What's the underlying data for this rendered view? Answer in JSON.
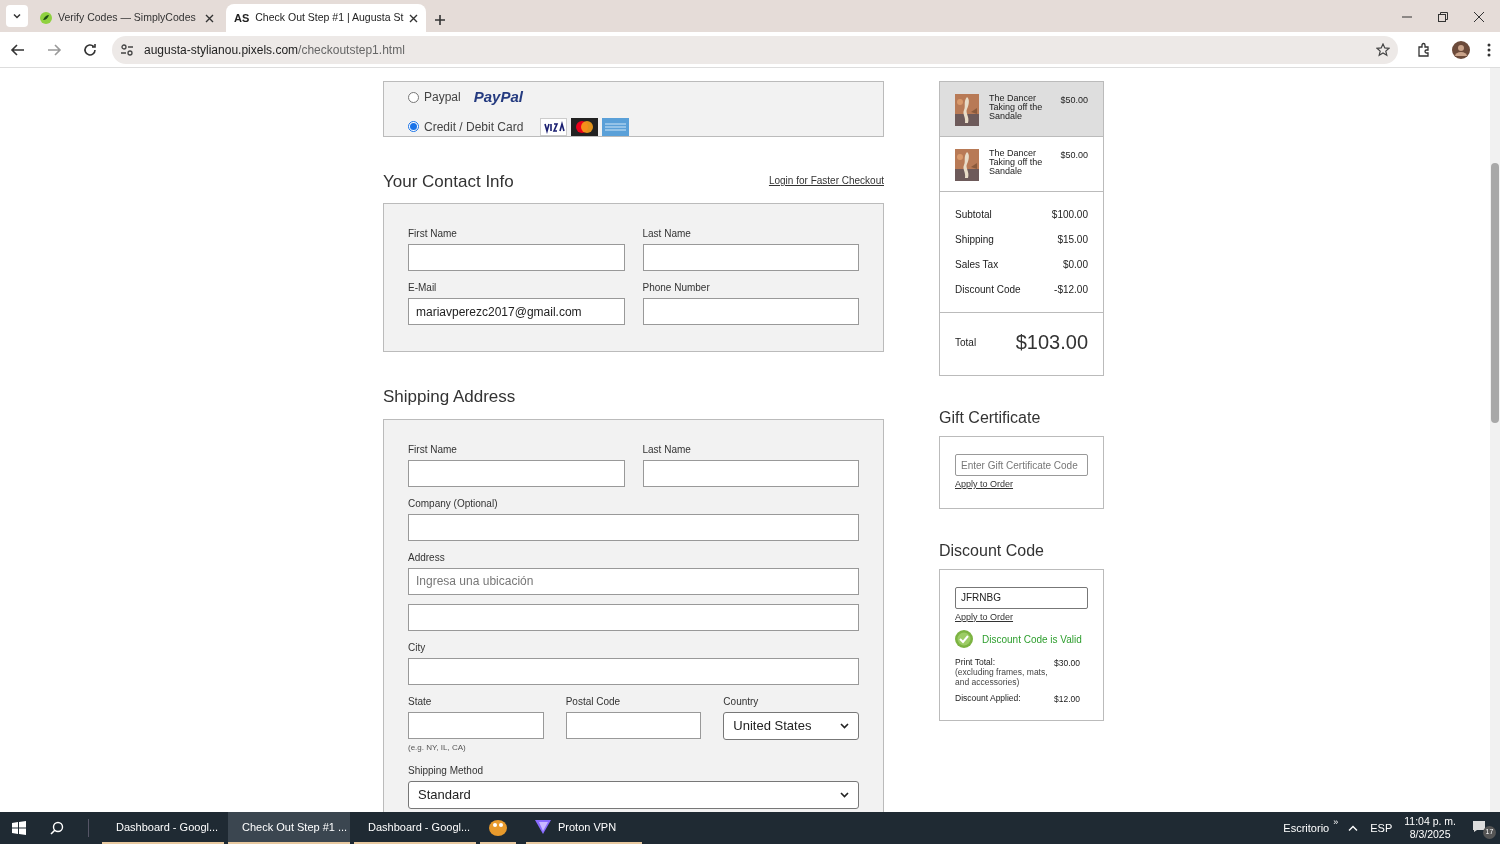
{
  "browser": {
    "tabs": [
      {
        "label": "Verify Codes — SimplyCodes",
        "selected": false,
        "kind": "leaf"
      },
      {
        "label": "Check Out Step #1 | Augusta St",
        "selected": true,
        "kind": "monogram",
        "monogram": "AS"
      }
    ],
    "url_host": "augusta-stylianou.pixels.com",
    "url_path": "/checkoutstep1.html"
  },
  "payment": {
    "options": [
      {
        "label": "Paypal",
        "selected": false,
        "kind": "paypal",
        "logo": "PayPal"
      },
      {
        "label": "Credit / Debit Card",
        "selected": true,
        "kind": "cards"
      }
    ]
  },
  "contact": {
    "title": "Your Contact Info",
    "link": "Login for Faster Checkout",
    "rows": [
      [
        {
          "label": "First Name"
        },
        {
          "label": "Last Name"
        }
      ],
      [
        {
          "label": "E-Mail",
          "value": "mariavperezc2017@gmail.com"
        },
        {
          "label": "Phone Number"
        }
      ]
    ]
  },
  "shipping": {
    "title": "Shipping Address",
    "rows": [
      [
        {
          "label": "First Name"
        },
        {
          "label": "Last Name"
        }
      ],
      [
        {
          "label": "Company (Optional)"
        }
      ],
      [
        {
          "label": "Address",
          "placeholder": "Ingresa una ubicación"
        }
      ],
      [
        {}
      ],
      [
        {
          "label": "City"
        }
      ],
      [
        {
          "label": "State",
          "hint": "(e.g. NY, IL, CA)"
        },
        {
          "label": "Postal Code"
        },
        {
          "label": "Country",
          "kind": "select",
          "value": "United States"
        }
      ],
      [
        {
          "label": "Shipping Method",
          "kind": "select",
          "value": "Standard"
        }
      ]
    ]
  },
  "order_summary": {
    "items": [
      {
        "title": "The Dancer Taking off the Sandale",
        "price": "$50.00",
        "selected": true
      },
      {
        "title": "The Dancer Taking off the Sandale",
        "price": "$50.00",
        "selected": false
      }
    ],
    "lines": [
      {
        "label": "Subtotal",
        "value": "$100.00"
      },
      {
        "label": "Shipping",
        "value": "$15.00"
      },
      {
        "label": "Sales Tax",
        "value": "$0.00"
      },
      {
        "label": "Discount Code",
        "value": "-$12.00"
      }
    ],
    "total_label": "Total",
    "total": "$103.00"
  },
  "gift_certificate": {
    "title": "Gift Certificate",
    "placeholder": "Enter Gift Certificate Code",
    "link": "Apply to Order"
  },
  "discount_code": {
    "title": "Discount Code",
    "value": "JFRNBG",
    "link": "Apply to Order",
    "status": "Discount Code is Valid",
    "lines": [
      {
        "label": "Print Total:",
        "note": "(excluding frames, mats, and accessories)",
        "value": "$30.00"
      },
      {
        "label": "Discount Applied:",
        "value": "$12.00"
      }
    ]
  },
  "taskbar": {
    "items": [
      {
        "label": "Dashboard - Googl...",
        "selected": false,
        "kind": "chrome"
      },
      {
        "label": "Check Out Step #1 ...",
        "selected": true,
        "kind": "chrome"
      },
      {
        "label": "Dashboard - Googl...",
        "selected": false,
        "kind": "chrome"
      },
      {
        "kind": "app"
      },
      {
        "label": "Proton VPN",
        "selected": false,
        "kind": "vpn"
      }
    ],
    "desktop": "Escritorio",
    "chevron": "»",
    "lang": "ESP",
    "time": "11:04 p. m.",
    "date": "8/3/2025",
    "notifications": "17"
  }
}
